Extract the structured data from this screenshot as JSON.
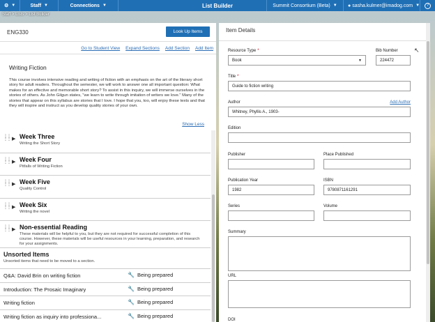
{
  "topbar": {
    "staff": "Staff",
    "connections": "Connections",
    "title": "List Builder",
    "org": "Summit Consortium (Beta)",
    "user": "sasha.kulmer@imadog.com",
    "help": "?"
  },
  "breadcrumb": "Staff > Lists > List Builder",
  "left": {
    "course": "ENG330",
    "lookup": "Look Up Items",
    "links": [
      "Go to Student View",
      "Expand Sections",
      "Add Section",
      "Add Item"
    ],
    "section_title": "Writing Fiction",
    "description": "This course involves intensive reading and writing of fiction with an emphasis on the art of the literary short story for adult readers. Throughout the semester, we will work to answer one all important question: What makes for an effective and memorable short story? To assist in this inquiry, we will immerse ourselves in the stories of others. As John Gilgun states, \"we learn to write through imitation of writers we love.\" Many of the stories that appear on this syllabus are stories that I love. I hope that you, too, will enjoy these texts and that they will inspire and instruct as you develop quality stories of your own.",
    "show_less": "Show Less",
    "weeks": [
      {
        "name": "Week Three",
        "sub": "Writing the Short Story"
      },
      {
        "name": "Week Four",
        "sub": "Pitfalls of Writing Fiction"
      },
      {
        "name": "Week Five",
        "sub": "Quality Control"
      },
      {
        "name": "Week Six",
        "sub": "Writing the novel"
      }
    ],
    "nonessential": {
      "name": "Non-essential Reading",
      "sub": "These materials will be helpful to you, but they are not required for successful completion of this course. However, these materials will be useful resources in your learning, preparation, and research for your assignments."
    },
    "unsorted": {
      "name": "Unsorted Items",
      "sub": "Unsorted items that need to be moved to a section."
    },
    "items": [
      {
        "title": "Q&A: David Brin on writing fiction",
        "status": "Being prepared"
      },
      {
        "title": "Introduction: The Prosaic Imaginary",
        "status": "Being prepared"
      },
      {
        "title": "Writing fiction",
        "status": "Being prepared"
      },
      {
        "title": "Writing fiction as inquiry into professiona...",
        "status": "Being prepared"
      }
    ]
  },
  "details": {
    "header": "Item Details",
    "resource_type_label": "Resource Type",
    "resource_type_value": "Book",
    "bib_label": "Bib Number",
    "bib_value": "224472",
    "title_label": "Title",
    "title_value": "Guide to fiction writing",
    "author_label": "Author",
    "add_author": "Add Author",
    "author_value": "Whitney, Phyllis A., 1903-",
    "edition_label": "Edition",
    "edition_value": "",
    "publisher_label": "Publisher",
    "publisher_value": "",
    "place_label": "Place Published",
    "place_value": "",
    "year_label": "Publication Year",
    "year_value": "1982",
    "isbn_label": "ISBN",
    "isbn_value": "9780871161291",
    "series_label": "Series",
    "series_value": "",
    "volume_label": "Volume",
    "volume_value": "",
    "summary_label": "Summary",
    "url_label": "URL",
    "doi_label": "DOI"
  },
  "colors": {
    "brand": "#1f6fb5",
    "required": "#d0021b",
    "link": "#2a6db4"
  },
  "icons": [
    "home-icon",
    "chevron-down-icon",
    "user-icon",
    "help-icon",
    "wrench-icon",
    "drag-handle-icon",
    "expand-triangle-icon"
  ]
}
